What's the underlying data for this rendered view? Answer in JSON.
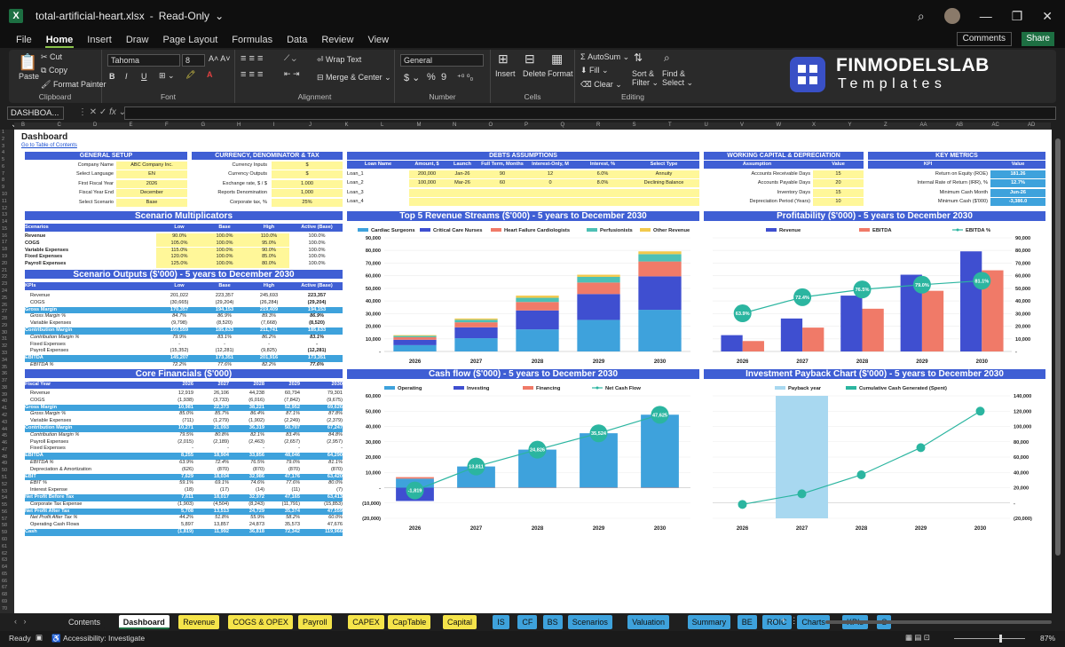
{
  "window": {
    "title": "total-artificial-heart.xlsx",
    "mode": "Read-Only"
  },
  "menu": [
    "File",
    "Home",
    "Insert",
    "Draw",
    "Page Layout",
    "Formulas",
    "Data",
    "Review",
    "View"
  ],
  "menu_active": "Home",
  "actions": {
    "comments": "Comments",
    "share": "Share"
  },
  "ribbon": {
    "paste": "Paste",
    "cut": "Cut",
    "copy": "Copy",
    "format_painter": "Format Painter",
    "clipboard": "Clipboard",
    "font_name": "Tahoma",
    "font_size": "8",
    "font": "Font",
    "bold": "B",
    "italic": "I",
    "underline": "U",
    "wrap": "Wrap Text",
    "merge": "Merge & Center",
    "alignment": "Alignment",
    "numfmt": "General",
    "number": "Number",
    "percent": "%",
    "comma": "9",
    "insert": "Insert",
    "delete": "Delete",
    "format": "Format",
    "cells": "Cells",
    "autosum": "AutoSum",
    "fill": "Fill",
    "clear": "Clear",
    "sort": "Sort &",
    "sort2": "Filter",
    "find": "Find &",
    "find2": "Select",
    "editing": "Editing"
  },
  "logo": {
    "line1": "FINMODELSLAB",
    "line2": "Templates"
  },
  "namebox": "DASHBOA...",
  "fx": "fx",
  "columns": [
    "B",
    "C",
    "D",
    "E",
    "F",
    "G",
    "H",
    "I",
    "J",
    "K",
    "L",
    "M",
    "N",
    "O",
    "P",
    "Q",
    "R",
    "S",
    "T",
    "U",
    "V",
    "W",
    "X",
    "Y",
    "Z",
    "AA",
    "AB",
    "AC",
    "AD"
  ],
  "sheet": {
    "title": "Dashboard",
    "toc": "Go to Table of Contents",
    "general": {
      "title": "GENERAL SETUP",
      "rows": [
        [
          "Company Name",
          "ABC Company Inc."
        ],
        [
          "Select Language",
          "EN"
        ],
        [
          "First Fiscal Year",
          "2026"
        ],
        [
          "Fiscal Year End",
          "December"
        ],
        [
          "Select Scenario",
          "Base"
        ]
      ]
    },
    "currency": {
      "title": "CURRENCY, DENOMINATOR & TAX",
      "rows": [
        [
          "Currency Inputs",
          "$"
        ],
        [
          "Currency Outputs",
          "$"
        ],
        [
          "Exchange rate, $ / $",
          "1.000"
        ],
        [
          "Reports Denomination",
          "1,000"
        ],
        [
          "Corporate tax, %",
          "25%"
        ]
      ]
    },
    "debts": {
      "title": "DEBTS ASSUMPTIONS",
      "headers": [
        "Loan Name",
        "Amount, $",
        "Launch",
        "Full Term, Months",
        "Interest-Only, M",
        "Interest, %",
        "Select Type"
      ],
      "rows": [
        [
          "Loan_1",
          "200,000",
          "Jan-26",
          "90",
          "12",
          "6.0%",
          "Annuity"
        ],
        [
          "Loan_2",
          "100,000",
          "Mar-26",
          "60",
          "0",
          "8.0%",
          "Declining Balance"
        ],
        [
          "Loan_3",
          "",
          "",
          "",
          "",
          "",
          ""
        ],
        [
          "Loan_4",
          "",
          "",
          "",
          "",
          "",
          ""
        ]
      ]
    },
    "wc": {
      "title": "WORKING CAPITAL & DEPRECIATION",
      "headers": [
        "Assumption",
        "Value"
      ],
      "rows": [
        [
          "Accounts Receivable Days",
          "15"
        ],
        [
          "Accounts Payable Days",
          "20"
        ],
        [
          "Inventory Days",
          "15"
        ],
        [
          "Depreciation Period (Years)",
          "10"
        ]
      ]
    },
    "kpi": {
      "title": "KEY METRICS",
      "headers": [
        "KPI",
        "Value"
      ],
      "rows": [
        [
          "Return on Equity (ROE)",
          "181.26"
        ],
        [
          "Internal Rate of Return (IRR), %",
          "12.7%"
        ],
        [
          "Minimum Cash Month",
          "Jun-26"
        ],
        [
          "Minimum Cash ($'000)",
          "-3,386.0"
        ]
      ]
    },
    "multipliers": {
      "title": "Scenario Multiplicators",
      "headers": [
        "Scenarios",
        "Low",
        "Base",
        "High",
        "Active (Base)"
      ],
      "rows": [
        [
          "Revenue",
          "90.0%",
          "100.0%",
          "110.0%",
          "100.0%"
        ],
        [
          "COGS",
          "105.0%",
          "100.0%",
          "95.0%",
          "100.0%"
        ],
        [
          "Variable Expenses",
          "115.0%",
          "100.0%",
          "90.0%",
          "100.0%"
        ],
        [
          "Fixed Expenses",
          "120.0%",
          "100.0%",
          "85.0%",
          "100.0%"
        ],
        [
          "Payroll Expenses",
          "125.0%",
          "100.0%",
          "80.0%",
          "100.0%"
        ]
      ]
    },
    "outputs": {
      "title": "Scenario Outputs ($'000) - 5 years to December 2030",
      "headers": [
        "KPIs",
        "Low",
        "Base",
        "High",
        "Active (Base)"
      ],
      "rows": [
        [
          "Revenue",
          "201,022",
          "223,357",
          "245,693",
          "223,357",
          ""
        ],
        [
          "COGS",
          "(30,665)",
          "(29,204)",
          "(26,284)",
          "(29,204)",
          ""
        ],
        [
          "Gross Margin",
          "170,357",
          "194,153",
          "219,409",
          "194,153",
          "hl"
        ],
        [
          "Gross Margin %",
          "84.7%",
          "86.9%",
          "89.3%",
          "86.9%",
          "i"
        ],
        [
          "Variable Expenses",
          "(9,798)",
          "(8,520)",
          "(7,668)",
          "(8,520)",
          ""
        ],
        [
          "Contribution Margin",
          "160,559",
          "185,633",
          "211,741",
          "185,633",
          "hl"
        ],
        [
          "Contribution Margin %",
          "79.9%",
          "83.1%",
          "86.2%",
          "83.1%",
          "i"
        ],
        [
          "Fixed Expenses",
          "-",
          "-",
          "-",
          "-",
          ""
        ],
        [
          "Payroll Expenses",
          "(15,352)",
          "(12,281)",
          "(9,825)",
          "(12,281)",
          ""
        ],
        [
          "EBITDA",
          "145,207",
          "173,351",
          "201,916",
          "173,351",
          "hl"
        ],
        [
          "EBITDA %",
          "72.2%",
          "77.6%",
          "82.2%",
          "77.6%",
          "i"
        ]
      ]
    },
    "core": {
      "title": "Core Financials ($'000)",
      "headers": [
        "Fiscal Year",
        "2026",
        "2027",
        "2028",
        "2029",
        "2030"
      ],
      "rows": [
        [
          "Revenue",
          "12,919",
          "26,106",
          "44,238",
          "60,794",
          "79,301",
          ""
        ],
        [
          "COGS",
          "(1,938)",
          "(3,733)",
          "(6,016)",
          "(7,842)",
          "(9,675)",
          ""
        ],
        [
          "Gross Margin",
          "10,981",
          "22,373",
          "38,221",
          "52,952",
          "69,626",
          "hl"
        ],
        [
          "Gross Margin %",
          "85.0%",
          "85.7%",
          "86.4%",
          "87.1%",
          "87.8%",
          "i"
        ],
        [
          "Variable Expenses",
          "(711)",
          "(1,279)",
          "(1,902)",
          "(2,249)",
          "(2,379)",
          ""
        ],
        [
          "Contribution Margin",
          "10,271",
          "21,093",
          "36,319",
          "50,707",
          "67,247",
          "hl"
        ],
        [
          "Contribution Margin %",
          "79.5%",
          "80.8%",
          "82.1%",
          "83.4%",
          "84.8%",
          "i"
        ],
        [
          "Payroll Expenses",
          "(2,015)",
          "(2,189)",
          "(2,463)",
          "(2,657)",
          "(2,957)",
          ""
        ],
        [
          "Fixed Expenses",
          "-",
          "-",
          "-",
          "-",
          "-",
          ""
        ],
        [
          "EBITDA",
          "8,255",
          "18,904",
          "33,856",
          "48,046",
          "64,290",
          "hl"
        ],
        [
          "EBITDA %",
          "63.9%",
          "72.4%",
          "76.5%",
          "79.0%",
          "81.1%",
          "i"
        ],
        [
          "Depreciation & Amortization",
          "(626)",
          "(870)",
          "(870)",
          "(870)",
          "(870)",
          ""
        ],
        [
          "EBIT",
          "7,629",
          "18,034",
          "32,986",
          "47,176",
          "63,420",
          "hl"
        ],
        [
          "EBIT %",
          "59.1%",
          "69.1%",
          "74.6%",
          "77.6%",
          "80.0%",
          "i"
        ],
        [
          "Interest Expense",
          "(18)",
          "(17)",
          "(14)",
          "(11)",
          "(7)",
          ""
        ],
        [
          "Net Profit Before Tax",
          "7,611",
          "18,017",
          "32,972",
          "47,165",
          "63,413",
          "hl"
        ],
        [
          "Corporate Tax Expense",
          "(1,903)",
          "(4,504)",
          "(8,243)",
          "(11,791)",
          "(15,853)",
          ""
        ],
        [
          "Net Profit After Tax",
          "5,708",
          "13,513",
          "24,729",
          "35,374",
          "47,559",
          "hl"
        ],
        [
          "Net Profit After Tax %",
          "44.2%",
          "51.8%",
          "55.9%",
          "58.2%",
          "60.0%",
          "i"
        ],
        [
          "Operating Cash Flows",
          "5,897",
          "13,857",
          "24,873",
          "35,573",
          "47,676",
          ""
        ],
        [
          "Cash",
          "(1,819)",
          "11,992",
          "36,818",
          "72,342",
          "119,966",
          "hl"
        ]
      ]
    }
  },
  "chart_data": [
    {
      "type": "bar",
      "title": "Top 5 Revenue Streams ($'000) - 5 years to December 2030",
      "categories": [
        "2026",
        "2027",
        "2028",
        "2029",
        "2030"
      ],
      "stacked": true,
      "ylim": [
        0,
        90000
      ],
      "yticks": [
        "-",
        "10,000",
        "20,000",
        "30,000",
        "40,000",
        "50,000",
        "60,000",
        "70,000",
        "80,000",
        "90,000"
      ],
      "series": [
        {
          "name": "Cardiac Surgeons",
          "values": [
            5000,
            10500,
            17500,
            25000,
            33000
          ],
          "color": "#3ea2dc"
        },
        {
          "name": "Critical Care Nurses",
          "values": [
            4300,
            8600,
            15000,
            20500,
            26500
          ],
          "color": "#3f4fd0"
        },
        {
          "name": "Heart Failure Cardiologists",
          "values": [
            2000,
            4000,
            6700,
            9100,
            11800
          ],
          "color": "#f07a68"
        },
        {
          "name": "Perfusionists",
          "values": [
            1000,
            2000,
            3300,
            4500,
            5800
          ],
          "color": "#4dc0b5"
        },
        {
          "name": "Other Revenue",
          "values": [
            619,
            1006,
            1738,
            1694,
            2201
          ],
          "color": "#f2c94c"
        }
      ]
    },
    {
      "type": "bar",
      "title": "Profitability ($'000) - 5 years to December 2030",
      "categories": [
        "2026",
        "2027",
        "2028",
        "2029",
        "2030"
      ],
      "ylim": [
        0,
        90000
      ],
      "yticks": [
        "-",
        "10,000",
        "20,000",
        "30,000",
        "40,000",
        "50,000",
        "60,000",
        "70,000",
        "80,000",
        "90,000"
      ],
      "series": [
        {
          "name": "Revenue",
          "values": [
            12919,
            26106,
            44238,
            60794,
            79301
          ],
          "color": "#3f4fd0"
        },
        {
          "name": "EBITDA",
          "values": [
            8255,
            18904,
            33856,
            48046,
            64290
          ],
          "color": "#f07a68"
        },
        {
          "name": "EBITDA %",
          "values": [
            63.9,
            72.4,
            76.5,
            79.0,
            81.1
          ],
          "labels": [
            "63.9%",
            "72.4%",
            "76.5%",
            "79.0%",
            "81.1%"
          ],
          "color": "#2bb5a0",
          "line": true
        }
      ]
    },
    {
      "type": "bar",
      "title": "Cash flow ($'000) - 5 years to December 2030",
      "categories": [
        "2026",
        "2027",
        "2028",
        "2029",
        "2030"
      ],
      "ylim": [
        -20000,
        60000
      ],
      "yticks": [
        "(20,000)",
        "(10,000)",
        "-",
        "10,000",
        "20,000",
        "30,000",
        "40,000",
        "50,000",
        "60,000"
      ],
      "series": [
        {
          "name": "Operating",
          "values": [
            5897,
            13857,
            24873,
            35573,
            47676
          ],
          "color": "#3ea2dc"
        },
        {
          "name": "Investing",
          "values": [
            -8700,
            0,
            0,
            0,
            0
          ],
          "color": "#3f4fd0"
        },
        {
          "name": "Financing",
          "values": [
            1000,
            -200,
            -200,
            -200,
            -200
          ],
          "color": "#f07a68"
        },
        {
          "name": "Net Cash Flow",
          "values": [
            -1819,
            13811,
            24826,
            35524,
            47625
          ],
          "labels": [
            "-1,819",
            "13,811",
            "24,826",
            "35,524",
            "47,625"
          ],
          "color": "#2bb5a0",
          "line": true
        }
      ]
    },
    {
      "type": "line",
      "title": "Investment Payback Chart ($'000) - 5 years to December 2030",
      "categories": [
        "2026",
        "2027",
        "2028",
        "2029",
        "2030"
      ],
      "ylim": [
        -20000,
        140000
      ],
      "yticks": [
        "(20,000)",
        "-",
        "20,000",
        "40,000",
        "60,000",
        "80,000",
        "100,000",
        "120,000",
        "140,000"
      ],
      "series": [
        {
          "name": "Payback year",
          "values": [
            0,
            140000,
            0,
            0,
            0
          ],
          "color": "#a8d8f0",
          "bar": true
        },
        {
          "name": "Cumulative Cash Generated (Spent)",
          "values": [
            -1819,
            11992,
            36818,
            72342,
            119966
          ],
          "color": "#2bb5a0"
        }
      ]
    }
  ],
  "tabs": [
    {
      "name": "Contents",
      "c": "#1f1f1f"
    },
    {
      "name": "Dashboard",
      "c": "#fff"
    },
    {
      "name": "Revenue",
      "c": "#f5e44a"
    },
    {
      "name": "COGS & OPEX",
      "c": "#f5e44a"
    },
    {
      "name": "Payroll",
      "c": "#f5e44a"
    },
    {
      "name": "CAPEX",
      "c": "#f5e44a"
    },
    {
      "name": "CapTable",
      "c": "#f5e44a"
    },
    {
      "name": "Capital",
      "c": "#f5e44a"
    },
    {
      "name": "IS",
      "c": "#3ea2dc"
    },
    {
      "name": "CF",
      "c": "#3ea2dc"
    },
    {
      "name": "BS",
      "c": "#3ea2dc"
    },
    {
      "name": "Scenarios",
      "c": "#3ea2dc"
    },
    {
      "name": "Valuation",
      "c": "#3ea2dc"
    },
    {
      "name": "Summary",
      "c": "#3ea2dc"
    },
    {
      "name": "BE",
      "c": "#3ea2dc"
    },
    {
      "name": "ROIC",
      "c": "#3ea2dc"
    },
    {
      "name": "Charts",
      "c": "#3ea2dc"
    },
    {
      "name": "KPIs",
      "c": "#3ea2dc"
    },
    {
      "name": "S",
      "c": "#3ea2dc"
    }
  ],
  "status": {
    "ready": "Ready",
    "accessibility": "Accessibility: Investigate",
    "zoom": "87%"
  }
}
